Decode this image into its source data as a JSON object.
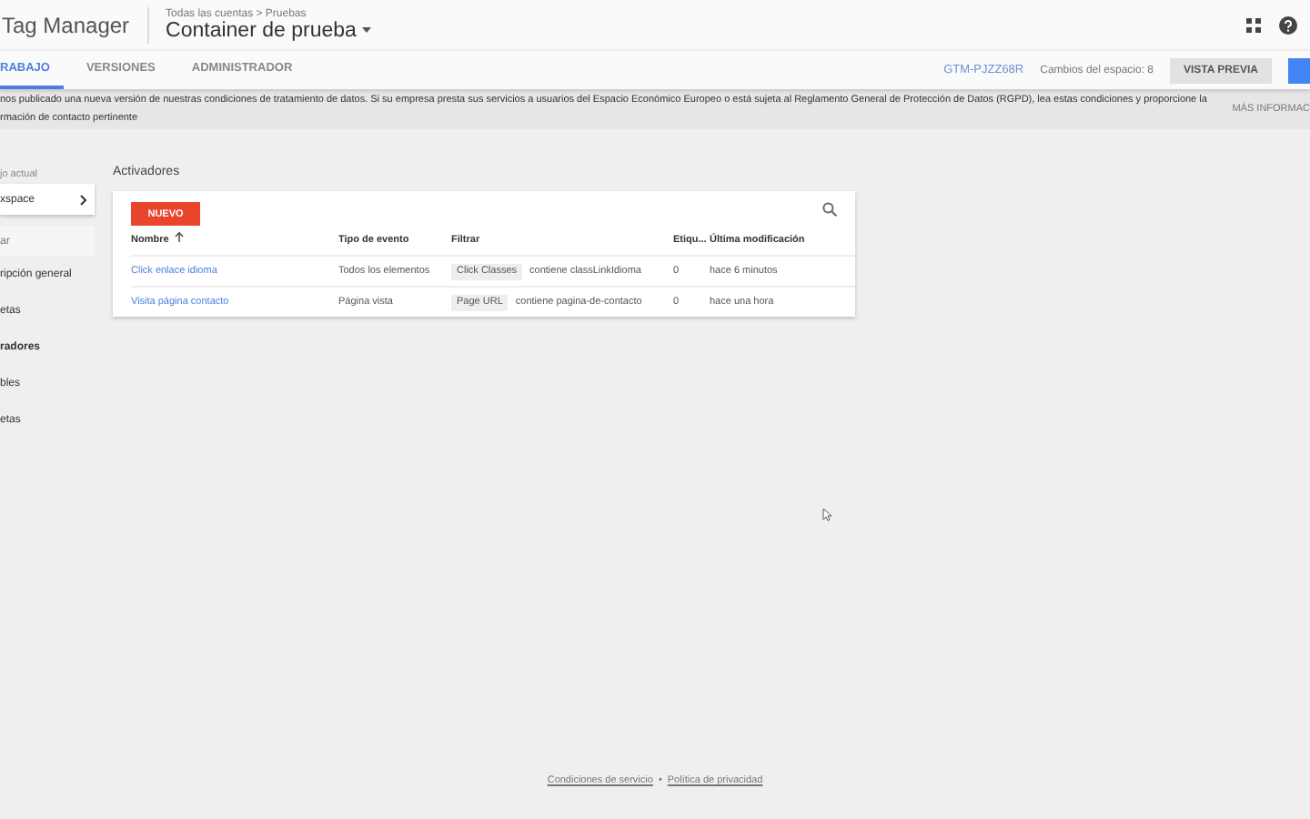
{
  "header": {
    "product": "Tag Manager",
    "breadcrumb": "Todas las cuentas > Pruebas",
    "container": "Container de prueba"
  },
  "tabs": [
    {
      "label": "RABAJO",
      "selected": true
    },
    {
      "label": "VERSIONES",
      "selected": false
    },
    {
      "label": "ADMINISTRADOR",
      "selected": false
    }
  ],
  "toolbar": {
    "container_id": "GTM-PJZZ68R",
    "changes": "Cambios del espacio: 8",
    "preview": "VISTA PREVIA"
  },
  "banner": {
    "text": "nos publicado una nueva versión de nuestras condiciones de tratamiento de datos. Si su empresa presta sus servicios a usuarios del Espacio Económico Europeo o está sujeta al Reglamento General de Protección de Datos (RGPD), lea estas condiciones y proporcione la",
    "text_2": "rmación de contacto pertinente",
    "link": "MÁS INFORMAC"
  },
  "sidebar": {
    "workspace_label": "jo actual",
    "workspace": "xspace",
    "search_placeholder": "ar",
    "items": [
      {
        "label": "ripción general",
        "selected": false
      },
      {
        "label": "etas",
        "selected": false
      },
      {
        "label": "radores",
        "selected": true
      },
      {
        "label": "bles",
        "selected": false
      },
      {
        "label": "etas",
        "selected": false
      }
    ]
  },
  "page_title": "Activadores",
  "new_button": "NUEVO",
  "table": {
    "columns": [
      "Nombre",
      "Tipo de evento",
      "Filtrar",
      "Etiqu...",
      "Última modificación"
    ],
    "rows": [
      {
        "name": "Click enlace idioma",
        "event": "Todos los elementos",
        "filter_var": "Click Classes",
        "filter_rule": "contiene classLinkIdioma",
        "tags": "0",
        "modified": "hace 6 minutos"
      },
      {
        "name": "Visita página contacto",
        "event": "Página vista",
        "filter_var": "Page URL",
        "filter_rule": "contiene pagina-de-contacto",
        "tags": "0",
        "modified": "hace una hora"
      }
    ]
  },
  "footer": {
    "links": [
      "Condiciones de servicio",
      "Política de privacidad"
    ],
    "separator": "•"
  }
}
